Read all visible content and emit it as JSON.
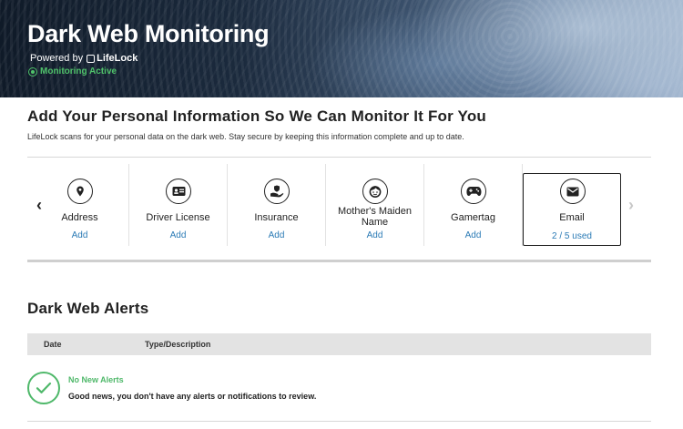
{
  "hero": {
    "title": "Dark Web Monitoring",
    "powered_by": "Powered by",
    "brand": "LifeLock",
    "status": "Monitoring Active"
  },
  "personal_info": {
    "title": "Add Your Personal Information So We Can Monitor It For You",
    "description": "LifeLock scans for your personal data on the dark web. Stay secure by keeping this information complete and up to date.",
    "tiles": [
      {
        "icon": "location-pin-icon",
        "label": "Address",
        "action": "Add"
      },
      {
        "icon": "id-card-icon",
        "label": "Driver License",
        "action": "Add"
      },
      {
        "icon": "insurance-hand-icon",
        "label": "Insurance",
        "action": "Add"
      },
      {
        "icon": "face-icon",
        "label": "Mother's Maiden Name",
        "action": "Add"
      },
      {
        "icon": "gamepad-icon",
        "label": "Gamertag",
        "action": "Add"
      },
      {
        "icon": "envelope-icon",
        "label": "Email",
        "action": "2 / 5 used"
      }
    ],
    "prev_arrow": "‹",
    "next_arrow": "›"
  },
  "alerts": {
    "title": "Dark Web Alerts",
    "columns": [
      "Date",
      "Type/Description"
    ],
    "empty_title": "No New Alerts",
    "empty_text": "Good news, you don't have any alerts or notifications to review."
  },
  "colors": {
    "accent_green": "#4fb86a",
    "link_blue": "#2a7ab5"
  }
}
